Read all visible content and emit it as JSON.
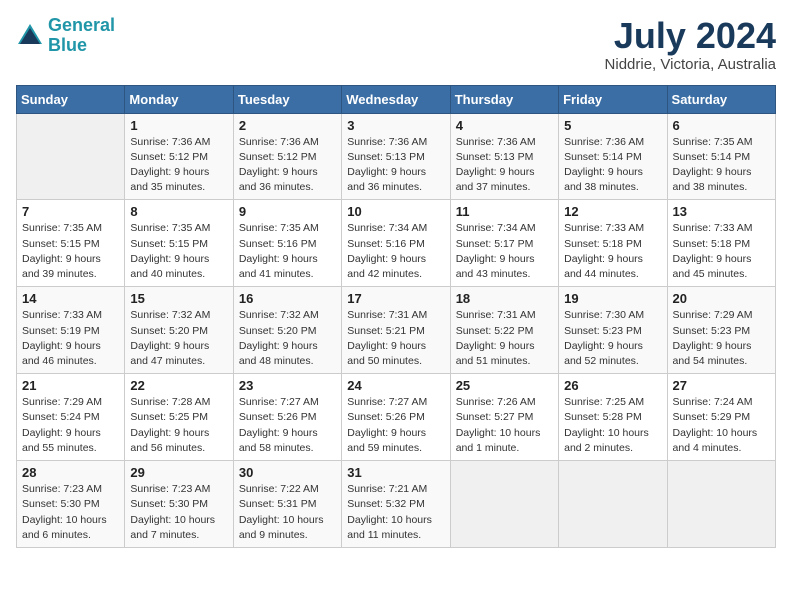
{
  "header": {
    "logo_line1": "General",
    "logo_line2": "Blue",
    "month": "July 2024",
    "location": "Niddrie, Victoria, Australia"
  },
  "weekdays": [
    "Sunday",
    "Monday",
    "Tuesday",
    "Wednesday",
    "Thursday",
    "Friday",
    "Saturday"
  ],
  "weeks": [
    [
      {
        "day": "",
        "info": ""
      },
      {
        "day": "1",
        "info": "Sunrise: 7:36 AM\nSunset: 5:12 PM\nDaylight: 9 hours\nand 35 minutes."
      },
      {
        "day": "2",
        "info": "Sunrise: 7:36 AM\nSunset: 5:12 PM\nDaylight: 9 hours\nand 36 minutes."
      },
      {
        "day": "3",
        "info": "Sunrise: 7:36 AM\nSunset: 5:13 PM\nDaylight: 9 hours\nand 36 minutes."
      },
      {
        "day": "4",
        "info": "Sunrise: 7:36 AM\nSunset: 5:13 PM\nDaylight: 9 hours\nand 37 minutes."
      },
      {
        "day": "5",
        "info": "Sunrise: 7:36 AM\nSunset: 5:14 PM\nDaylight: 9 hours\nand 38 minutes."
      },
      {
        "day": "6",
        "info": "Sunrise: 7:35 AM\nSunset: 5:14 PM\nDaylight: 9 hours\nand 38 minutes."
      }
    ],
    [
      {
        "day": "7",
        "info": "Sunrise: 7:35 AM\nSunset: 5:15 PM\nDaylight: 9 hours\nand 39 minutes."
      },
      {
        "day": "8",
        "info": "Sunrise: 7:35 AM\nSunset: 5:15 PM\nDaylight: 9 hours\nand 40 minutes."
      },
      {
        "day": "9",
        "info": "Sunrise: 7:35 AM\nSunset: 5:16 PM\nDaylight: 9 hours\nand 41 minutes."
      },
      {
        "day": "10",
        "info": "Sunrise: 7:34 AM\nSunset: 5:16 PM\nDaylight: 9 hours\nand 42 minutes."
      },
      {
        "day": "11",
        "info": "Sunrise: 7:34 AM\nSunset: 5:17 PM\nDaylight: 9 hours\nand 43 minutes."
      },
      {
        "day": "12",
        "info": "Sunrise: 7:33 AM\nSunset: 5:18 PM\nDaylight: 9 hours\nand 44 minutes."
      },
      {
        "day": "13",
        "info": "Sunrise: 7:33 AM\nSunset: 5:18 PM\nDaylight: 9 hours\nand 45 minutes."
      }
    ],
    [
      {
        "day": "14",
        "info": "Sunrise: 7:33 AM\nSunset: 5:19 PM\nDaylight: 9 hours\nand 46 minutes."
      },
      {
        "day": "15",
        "info": "Sunrise: 7:32 AM\nSunset: 5:20 PM\nDaylight: 9 hours\nand 47 minutes."
      },
      {
        "day": "16",
        "info": "Sunrise: 7:32 AM\nSunset: 5:20 PM\nDaylight: 9 hours\nand 48 minutes."
      },
      {
        "day": "17",
        "info": "Sunrise: 7:31 AM\nSunset: 5:21 PM\nDaylight: 9 hours\nand 50 minutes."
      },
      {
        "day": "18",
        "info": "Sunrise: 7:31 AM\nSunset: 5:22 PM\nDaylight: 9 hours\nand 51 minutes."
      },
      {
        "day": "19",
        "info": "Sunrise: 7:30 AM\nSunset: 5:23 PM\nDaylight: 9 hours\nand 52 minutes."
      },
      {
        "day": "20",
        "info": "Sunrise: 7:29 AM\nSunset: 5:23 PM\nDaylight: 9 hours\nand 54 minutes."
      }
    ],
    [
      {
        "day": "21",
        "info": "Sunrise: 7:29 AM\nSunset: 5:24 PM\nDaylight: 9 hours\nand 55 minutes."
      },
      {
        "day": "22",
        "info": "Sunrise: 7:28 AM\nSunset: 5:25 PM\nDaylight: 9 hours\nand 56 minutes."
      },
      {
        "day": "23",
        "info": "Sunrise: 7:27 AM\nSunset: 5:26 PM\nDaylight: 9 hours\nand 58 minutes."
      },
      {
        "day": "24",
        "info": "Sunrise: 7:27 AM\nSunset: 5:26 PM\nDaylight: 9 hours\nand 59 minutes."
      },
      {
        "day": "25",
        "info": "Sunrise: 7:26 AM\nSunset: 5:27 PM\nDaylight: 10 hours\nand 1 minute."
      },
      {
        "day": "26",
        "info": "Sunrise: 7:25 AM\nSunset: 5:28 PM\nDaylight: 10 hours\nand 2 minutes."
      },
      {
        "day": "27",
        "info": "Sunrise: 7:24 AM\nSunset: 5:29 PM\nDaylight: 10 hours\nand 4 minutes."
      }
    ],
    [
      {
        "day": "28",
        "info": "Sunrise: 7:23 AM\nSunset: 5:30 PM\nDaylight: 10 hours\nand 6 minutes."
      },
      {
        "day": "29",
        "info": "Sunrise: 7:23 AM\nSunset: 5:30 PM\nDaylight: 10 hours\nand 7 minutes."
      },
      {
        "day": "30",
        "info": "Sunrise: 7:22 AM\nSunset: 5:31 PM\nDaylight: 10 hours\nand 9 minutes."
      },
      {
        "day": "31",
        "info": "Sunrise: 7:21 AM\nSunset: 5:32 PM\nDaylight: 10 hours\nand 11 minutes."
      },
      {
        "day": "",
        "info": ""
      },
      {
        "day": "",
        "info": ""
      },
      {
        "day": "",
        "info": ""
      }
    ]
  ]
}
